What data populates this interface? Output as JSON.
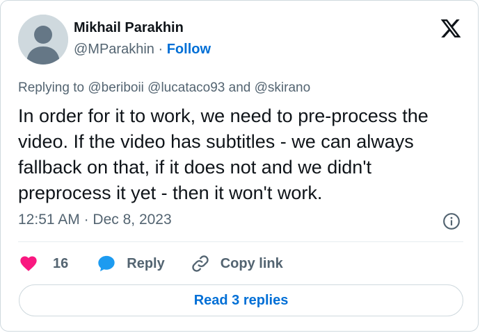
{
  "author": {
    "name": "Mikhail Parakhin",
    "handle": "@MParakhin",
    "separator": "·",
    "follow_label": "Follow"
  },
  "header": {
    "logo_icon": "x-logo-icon"
  },
  "reply_context": {
    "prefix": "Replying to",
    "mentions": [
      "@beriboii",
      "@lucataco93",
      "@skirano"
    ],
    "conjunction": "and"
  },
  "tweet": {
    "text": "In order for it to work, we need to pre-process the video. If the video has subtitles - we can always fallback on that, if it does not and we didn't preprocess it yet - then it won't work."
  },
  "meta": {
    "time": "12:51 AM",
    "separator": "·",
    "date": "Dec 8, 2023",
    "info_icon": "info-icon"
  },
  "actions": {
    "like_count": "16",
    "reply_label": "Reply",
    "copy_link_label": "Copy link"
  },
  "read_replies_label": "Read 3 replies",
  "colors": {
    "text": "#0f1419",
    "secondary": "#536471",
    "link": "#006fd6",
    "like": "#f91880",
    "reply": "#1d9bf0",
    "border": "#cfd9de"
  }
}
